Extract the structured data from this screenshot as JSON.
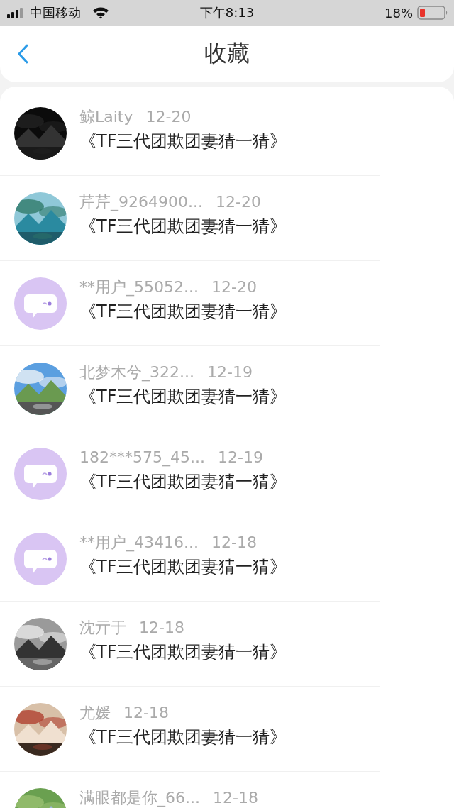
{
  "status_bar": {
    "carrier": "中国移动",
    "time": "下午8:13",
    "battery": "18%"
  },
  "header": {
    "title": "收藏"
  },
  "items": [
    {
      "name": "鲸Laity",
      "date": "12-20",
      "title": "《TF三代团欺团妻猜一猜》"
    },
    {
      "name": "芹芹_9264900...",
      "date": "12-20",
      "title": "《TF三代团欺团妻猜一猜》"
    },
    {
      "name": "**用户_55052...",
      "date": "12-20",
      "title": "《TF三代团欺团妻猜一猜》",
      "avatar": {
        "kind": "default"
      }
    },
    {
      "name": "北梦木兮_322...",
      "date": "12-19",
      "title": "《TF三代团欺团妻猜一猜》"
    },
    {
      "name": "182***575_45...",
      "date": "12-19",
      "title": "《TF三代团欺团妻猜一猜》",
      "avatar": {
        "kind": "default"
      }
    },
    {
      "name": "**用户_43416...",
      "date": "12-18",
      "title": "《TF三代团欺团妻猜一猜》",
      "avatar": {
        "kind": "default"
      }
    },
    {
      "name": "沈亓于",
      "date": "12-18",
      "title": "《TF三代团欺团妻猜一猜》"
    },
    {
      "name": "尤媛",
      "date": "12-18",
      "title": "《TF三代团欺团妻猜一猜》"
    },
    {
      "name": "满眼都是你_66...",
      "date": "12-18"
    }
  ]
}
